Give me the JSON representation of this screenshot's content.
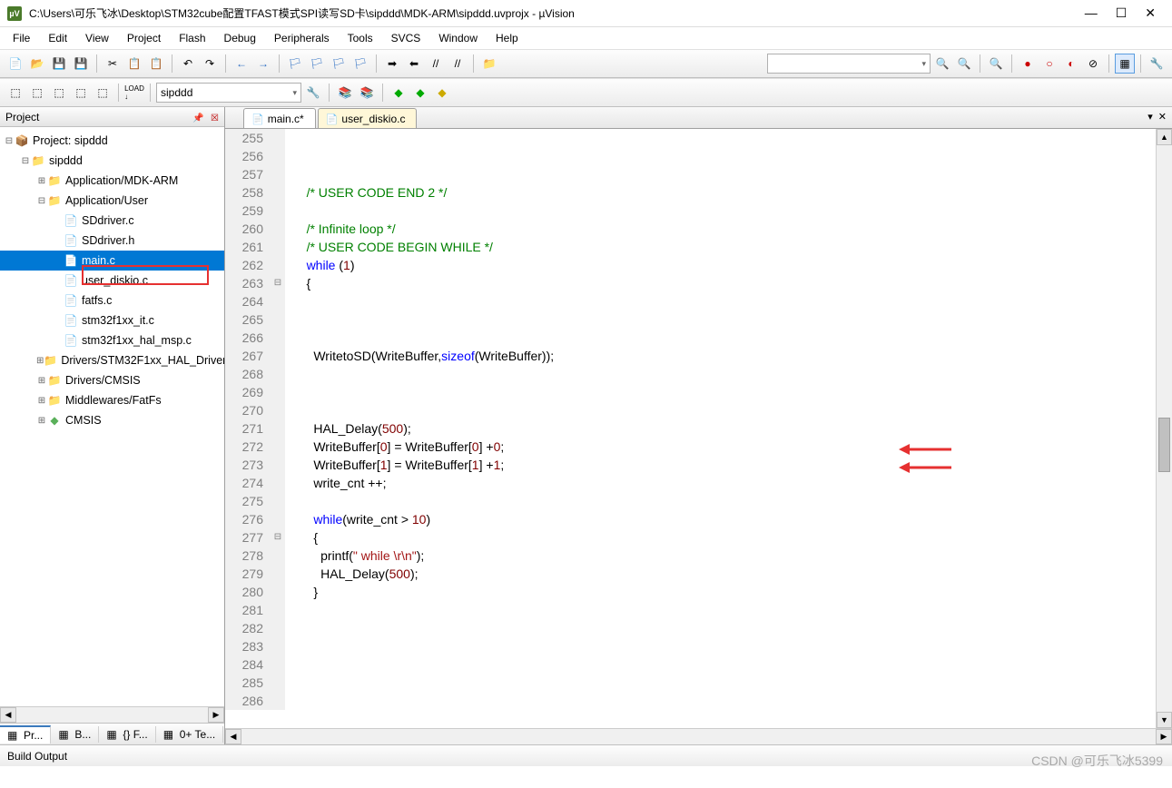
{
  "window": {
    "title": "C:\\Users\\可乐飞冰\\Desktop\\STM32cube配置TFAST模式SPI读写SD卡\\sipddd\\MDK-ARM\\sipddd.uvprojx - µVision",
    "min": "—",
    "max": "☐",
    "close": "✕"
  },
  "menu": [
    "File",
    "Edit",
    "View",
    "Project",
    "Flash",
    "Debug",
    "Peripherals",
    "Tools",
    "SVCS",
    "Window",
    "Help"
  ],
  "toolbar2": {
    "target": "sipddd"
  },
  "project": {
    "title": "Project",
    "root": "Project: sipddd",
    "target": "sipddd",
    "groups": [
      {
        "name": "Application/MDK-ARM",
        "expanded": false
      },
      {
        "name": "Application/User",
        "expanded": true,
        "files": [
          "SDdriver.c",
          "SDdriver.h",
          "main.c",
          "user_diskio.c",
          "fatfs.c",
          "stm32f1xx_it.c",
          "stm32f1xx_hal_msp.c"
        ]
      },
      {
        "name": "Drivers/STM32F1xx_HAL_Driver",
        "expanded": false
      },
      {
        "name": "Drivers/CMSIS",
        "expanded": false
      },
      {
        "name": "Middlewares/FatFs",
        "expanded": false
      },
      {
        "name": "CMSIS",
        "expanded": false,
        "comp": true
      }
    ],
    "selected_file": "main.c",
    "bottom_tabs": [
      "Pr...",
      "B...",
      "{} F...",
      "0+ Te..."
    ]
  },
  "editor": {
    "tabs": [
      {
        "label": "main.c*",
        "active": true
      },
      {
        "label": "user_diskio.c",
        "active": false
      }
    ],
    "lines": [
      {
        "n": 255,
        "html": ""
      },
      {
        "n": 256,
        "html": ""
      },
      {
        "n": 257,
        "html": ""
      },
      {
        "n": 258,
        "html": "    <span class='c-comment'>/* USER CODE END 2 */</span>"
      },
      {
        "n": 259,
        "html": ""
      },
      {
        "n": 260,
        "html": "    <span class='c-comment'>/* Infinite loop */</span>"
      },
      {
        "n": 261,
        "html": "    <span class='c-comment'>/* USER CODE BEGIN WHILE */</span>"
      },
      {
        "n": 262,
        "html": "    <span class='c-keyword'>while</span> (<span class='c-num'>1</span>)"
      },
      {
        "n": 263,
        "html": "    {",
        "fold": "⊟"
      },
      {
        "n": 264,
        "html": ""
      },
      {
        "n": 265,
        "html": ""
      },
      {
        "n": 266,
        "html": ""
      },
      {
        "n": 267,
        "html": "      WritetoSD(WriteBuffer,<span class='c-keyword'>sizeof</span>(WriteBuffer));"
      },
      {
        "n": 268,
        "html": ""
      },
      {
        "n": 269,
        "html": ""
      },
      {
        "n": 270,
        "html": ""
      },
      {
        "n": 271,
        "html": "      HAL_Delay(<span class='c-num'>500</span>);"
      },
      {
        "n": 272,
        "html": "      WriteBuffer[<span class='c-num'>0</span>] = WriteBuffer[<span class='c-num'>0</span>] +<span class='c-num'>0</span>;"
      },
      {
        "n": 273,
        "html": "      WriteBuffer[<span class='c-num'>1</span>] = WriteBuffer[<span class='c-num'>1</span>] +<span class='c-num'>1</span>;"
      },
      {
        "n": 274,
        "html": "      write_cnt ++;"
      },
      {
        "n": 275,
        "html": ""
      },
      {
        "n": 276,
        "html": "      <span class='c-keyword'>while</span>(write_cnt &gt; <span class='c-num'>10</span>)"
      },
      {
        "n": 277,
        "html": "      {",
        "fold": "⊟"
      },
      {
        "n": 278,
        "html": "        printf(<span class='c-str'>\" while \\r\\n\"</span>);"
      },
      {
        "n": 279,
        "html": "        HAL_Delay(<span class='c-num'>500</span>);"
      },
      {
        "n": 280,
        "html": "      }"
      },
      {
        "n": 281,
        "html": ""
      },
      {
        "n": 282,
        "html": ""
      },
      {
        "n": 283,
        "html": ""
      },
      {
        "n": 284,
        "html": ""
      },
      {
        "n": 285,
        "html": ""
      },
      {
        "n": 286,
        "html": ""
      }
    ]
  },
  "buildout": {
    "title": "Build Output"
  },
  "watermark": "CSDN @可乐飞冰5399"
}
